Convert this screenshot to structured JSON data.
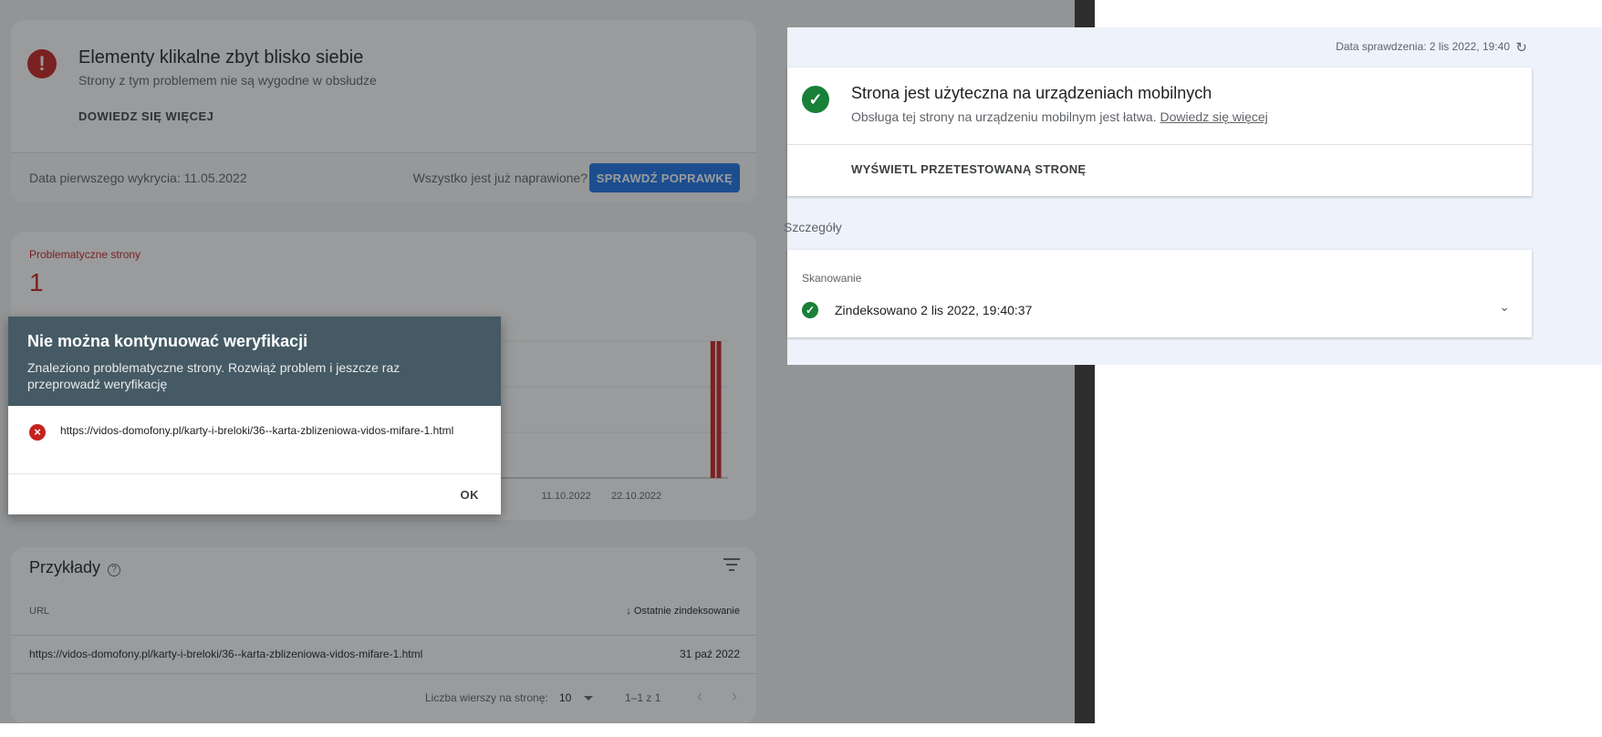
{
  "left_pane": {
    "issue_card": {
      "title": "Elementy klikalne zbyt blisko siebie",
      "subtitle": "Strony z tym problemem nie są wygodne w obsłudze",
      "learn_more": "DOWIEDZ SIĘ WIĘCEJ",
      "first_detected": "Data pierwszego wykrycia: 11.05.2022",
      "fixed_question": "Wszystko jest już naprawione?",
      "validate_fix": "SPRAWDŹ POPRAWKĘ"
    },
    "chart_card": {
      "label": "Problematyczne strony",
      "count": "1"
    },
    "examples_card": {
      "title": "Przykłady",
      "help_icon": "?",
      "col_url": "URL",
      "col_last": "Ostatnie zindeksowanie",
      "sort_icon": "↓",
      "row_url": "https://vidos-domofony.pl/karty-i-breloki/36--karta-zblizeniowa-vidos-mifare-1.html",
      "row_date": "31 paź 2022",
      "rows_per_page_label": "Liczba wierszy na stronę:",
      "rows_per_page_value": "10",
      "range": "1–1 z 1",
      "prev": "‹",
      "next": "›"
    }
  },
  "dialog": {
    "title": "Nie można kontynuować weryfikacji",
    "description": "Znaleziono problematyczne strony. Rozwiąż problem i jeszcze raz przeprowadź weryfikację",
    "url": "https://vidos-domofony.pl/karty-i-breloki/36--karta-zblizeniowa-vidos-mifare-1.html",
    "ok": "OK",
    "error_icon": "×"
  },
  "right_pane": {
    "checked_date": "Data sprawdzenia: 2 lis 2022, 19:40",
    "refresh_icon": "↻",
    "result_title": "Strona jest użyteczna na urządzeniach mobilnych",
    "result_desc": "Obsługa tej strony na urządzeniu mobilnym jest łatwa.",
    "result_link": "Dowiedz się więcej",
    "view_tested": "WYŚWIETL PRZETESTOWANĄ STRONĘ",
    "details_label": "Szczegóły",
    "crawl_label": "Skanowanie",
    "crawl_text": "Zindeksowano 2 lis 2022, 19:40:37",
    "check_icon": "✓",
    "expand_icon": "⌄"
  },
  "colors": {
    "error": "#c5221f",
    "success": "#188038",
    "dialog_header": "#455a64",
    "accent": "#1a73e8"
  },
  "chart_data": {
    "type": "bar",
    "x_tick_labels": [
      "11.10.2022",
      "22.10.2022"
    ],
    "values": [
      0,
      0,
      0,
      0,
      0,
      0,
      0,
      0,
      0,
      0,
      0,
      0,
      0,
      0,
      0,
      0,
      0,
      0,
      0,
      0,
      0,
      0,
      0,
      0,
      0,
      0,
      0,
      0,
      0,
      0,
      0,
      0,
      0,
      0,
      0,
      0,
      0,
      0,
      0,
      0,
      0,
      0,
      0,
      0,
      0,
      0,
      0,
      0,
      0,
      0,
      0,
      0,
      0,
      0,
      0,
      0,
      0,
      0,
      0,
      0,
      0,
      0,
      0,
      0,
      0,
      0,
      0,
      1,
      1,
      1,
      1,
      1,
      0,
      1,
      1,
      1,
      1,
      0,
      0,
      0,
      0,
      0,
      0,
      0,
      0,
      0,
      0,
      0,
      0,
      0,
      0,
      0,
      0,
      0,
      0,
      0,
      0,
      0,
      0,
      0,
      0,
      0,
      0,
      0,
      0,
      0,
      0,
      0,
      0,
      0,
      0,
      0,
      1,
      1,
      0
    ],
    "ylim": [
      0,
      1
    ],
    "grid": true,
    "legend": false
  }
}
